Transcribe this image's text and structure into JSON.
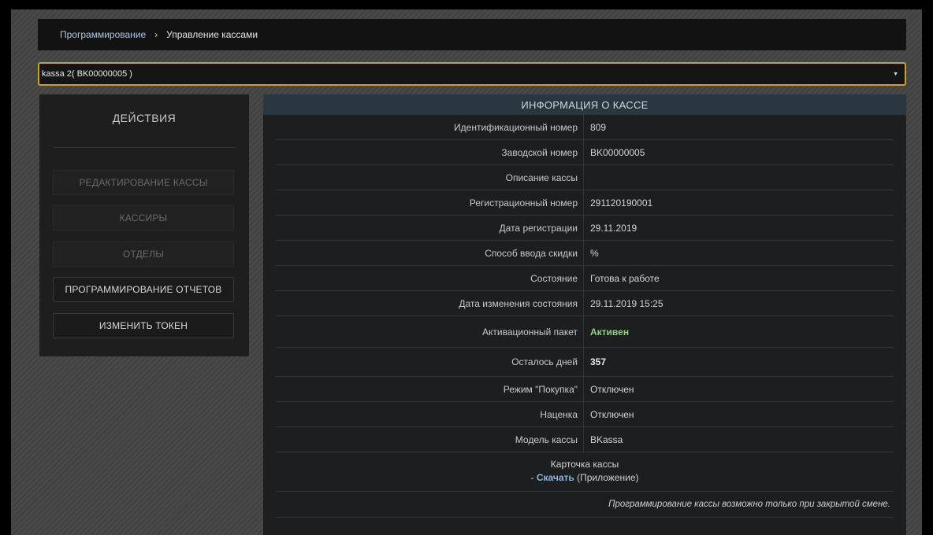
{
  "breadcrumb": {
    "items": [
      "Программирование",
      "Управление кассами"
    ],
    "separator": "›"
  },
  "kassa_select": {
    "selected": "kassa 2( BK00000005 )",
    "arrow": "▼"
  },
  "actions": {
    "title": "ДЕЙСТВИЯ",
    "buttons": [
      {
        "label": "РЕДАКТИРОВАНИЕ КАССЫ",
        "enabled": false
      },
      {
        "label": "КАССИРЫ",
        "enabled": false
      },
      {
        "label": "ОТДЕЛЫ",
        "enabled": false
      },
      {
        "label": "ПРОГРАММИРОВАНИЕ ОТЧЕТОВ",
        "enabled": true
      },
      {
        "label": "ИЗМЕНИТЬ ТОКЕН",
        "enabled": true
      }
    ]
  },
  "info": {
    "header": "ИНФОРМАЦИЯ О КАССЕ",
    "rows": [
      {
        "label": "Идентификационный номер",
        "value": "809"
      },
      {
        "label": "Заводской номер",
        "value": "BK00000005"
      },
      {
        "label": "Описание кассы",
        "value": ""
      },
      {
        "label": "Регистрационный номер",
        "value": "291120190001"
      },
      {
        "label": "Дата регистрации",
        "value": "29.11.2019"
      },
      {
        "label": "Способ ввода скидки",
        "value": "%"
      },
      {
        "label": "Состояние",
        "value": "Готова к работе"
      },
      {
        "label": "Дата изменения состояния",
        "value": "29.11.2019 15:25"
      },
      {
        "label": "Активационный пакет",
        "value": "Активен"
      },
      {
        "label": "Осталось дней",
        "value": "357"
      },
      {
        "label": "Режим \"Покупка\"",
        "value": "Отключен"
      },
      {
        "label": "Наценка",
        "value": "Отключен"
      },
      {
        "label": "Модель кассы",
        "value": "BKassa"
      }
    ],
    "card": {
      "title": "Карточка кассы",
      "prefix": "- ",
      "download_label": "Скачать",
      "app_label": "(Приложение)"
    },
    "note": "Программирование кассы возможно только при закрытой смене."
  },
  "colors": {
    "accent_border": "#c9a227",
    "active_status": "#8fcf86",
    "link": "#8ab4e0",
    "header_bg": "#2a3640"
  }
}
